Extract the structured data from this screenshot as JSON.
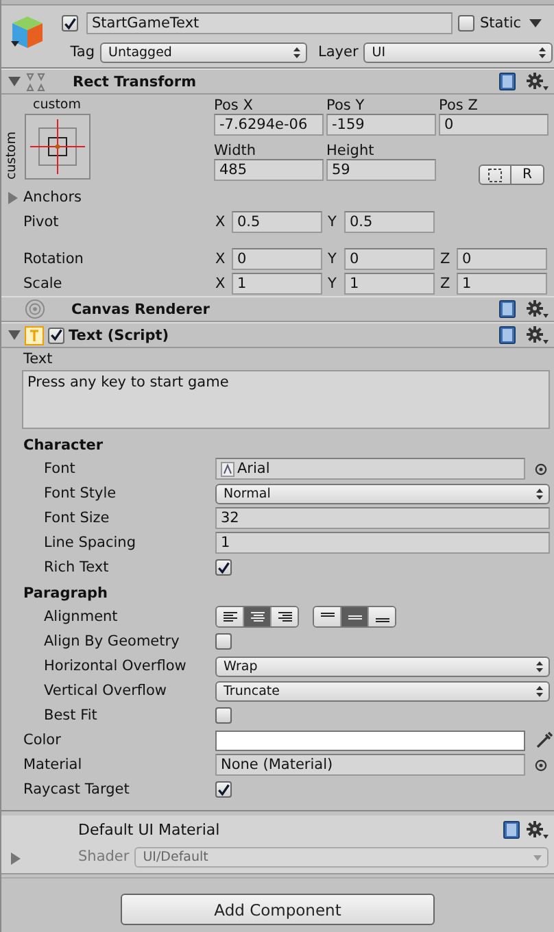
{
  "object": {
    "active": true,
    "name": "StartGameText",
    "static": false,
    "static_label": "Static",
    "tag_label": "Tag",
    "tag": "Untagged",
    "layer_label": "Layer",
    "layer": "UI"
  },
  "rect_transform": {
    "title": "Rect Transform",
    "expanded": true,
    "preset_top": "custom",
    "preset_side": "custom",
    "fields": [
      {
        "label": "Pos X",
        "value": "-7.6294e-06"
      },
      {
        "label": "Pos Y",
        "value": "-159"
      },
      {
        "label": "Pos Z",
        "value": "0"
      },
      {
        "label": "Width",
        "value": "485"
      },
      {
        "label": "Height",
        "value": "59"
      }
    ],
    "raw_label": "R",
    "anchors": {
      "label": "Anchors",
      "expanded": false
    },
    "vectors": [
      {
        "label": "Pivot",
        "axes": [
          {
            "axis": "X",
            "value": "0.5"
          },
          {
            "axis": "Y",
            "value": "0.5"
          }
        ]
      },
      {
        "label": "Rotation",
        "axes": [
          {
            "axis": "X",
            "value": "0"
          },
          {
            "axis": "Y",
            "value": "0"
          },
          {
            "axis": "Z",
            "value": "0"
          }
        ]
      },
      {
        "label": "Scale",
        "axes": [
          {
            "axis": "X",
            "value": "1"
          },
          {
            "axis": "Y",
            "value": "1"
          },
          {
            "axis": "Z",
            "value": "1"
          }
        ]
      }
    ]
  },
  "canvas_renderer": {
    "title": "Canvas Renderer"
  },
  "text_script": {
    "title": "Text (Script)",
    "expanded": true,
    "enabled": true,
    "text_label": "Text",
    "text": "Press any key to start game",
    "groups": [
      {
        "title": "Character",
        "properties": [
          {
            "kind": "object",
            "label": "Font",
            "value": "Arial"
          },
          {
            "kind": "dropdown",
            "label": "Font Style",
            "value": "Normal"
          },
          {
            "kind": "number",
            "label": "Font Size",
            "value": "32"
          },
          {
            "kind": "number",
            "label": "Line Spacing",
            "value": "1"
          },
          {
            "kind": "checkbox",
            "label": "Rich Text",
            "checked": true
          }
        ]
      },
      {
        "title": "Paragraph",
        "properties": [
          {
            "kind": "alignment",
            "label": "Alignment",
            "horizontal": [
              {
                "selected": false
              },
              {
                "selected": true
              },
              {
                "selected": false
              }
            ],
            "vertical": [
              {
                "selected": false
              },
              {
                "selected": true
              },
              {
                "selected": false
              }
            ]
          },
          {
            "kind": "checkbox",
            "label": "Align By Geometry",
            "checked": false
          },
          {
            "kind": "dropdown",
            "label": "Horizontal Overflow",
            "value": "Wrap"
          },
          {
            "kind": "dropdown",
            "label": "Vertical Overflow",
            "value": "Truncate"
          },
          {
            "kind": "checkbox",
            "label": "Best Fit",
            "checked": false
          }
        ]
      }
    ],
    "properties": [
      {
        "kind": "color",
        "label": "Color",
        "color": "#ffffff"
      },
      {
        "kind": "object",
        "label": "Material",
        "value": "None (Material)"
      },
      {
        "kind": "checkbox",
        "label": "Raycast Target",
        "checked": true
      }
    ]
  },
  "material": {
    "name": "Default UI Material",
    "expanded": false,
    "shader_label": "Shader",
    "shader": "UI/Default"
  },
  "add_component": "Add Component"
}
